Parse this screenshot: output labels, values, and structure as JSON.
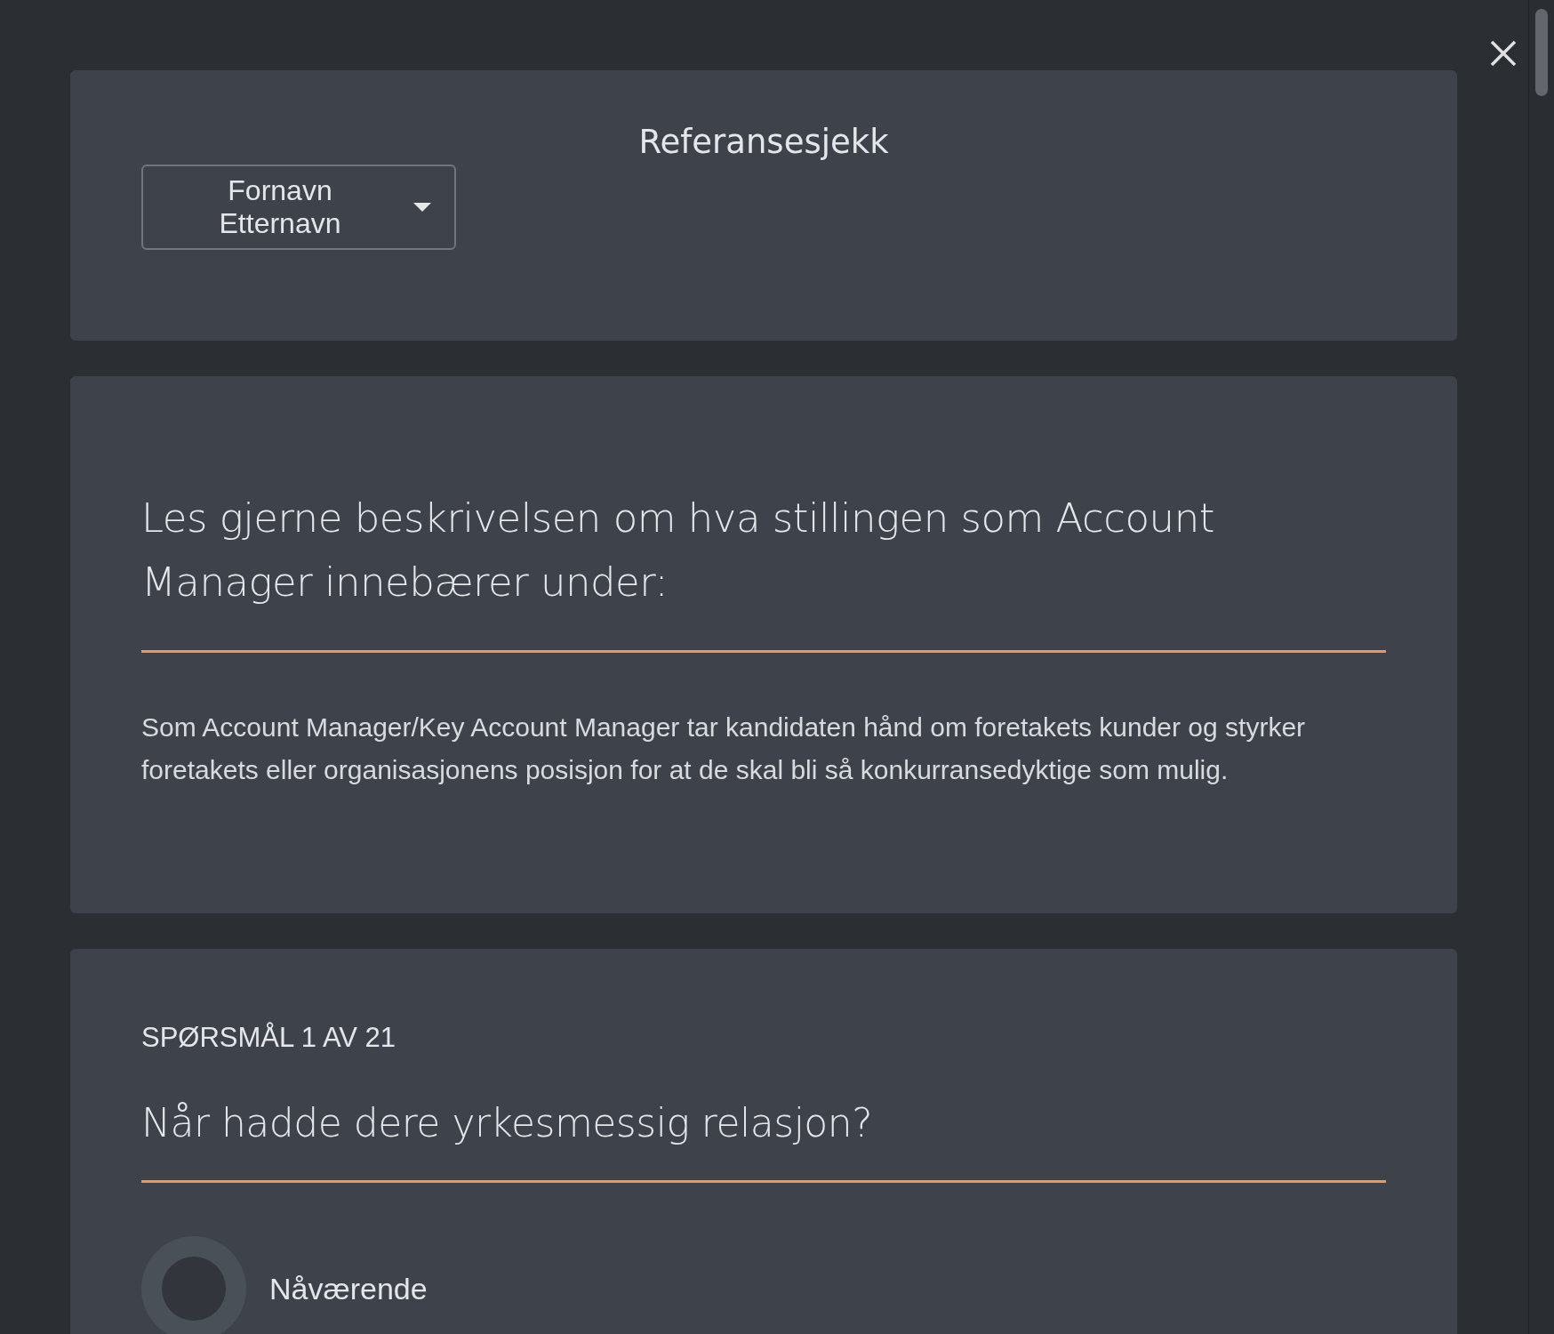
{
  "title": "Referansesjekk",
  "person_select": {
    "value": "Fornavn Etternavn"
  },
  "description_card": {
    "heading": "Les gjerne beskrivelsen om hva stillingen som Account Manager innebærer under:",
    "text": "Som Account Manager/Key Account Manager tar kandidaten hånd om foretakets kunder og styrker foretakets eller organisasjonens posisjon for at de skal bli så konkurransedyktige som mulig."
  },
  "question_card": {
    "counter": "SPØRSMÅL 1 AV 21",
    "question": "Når hadde dere yrkesmessig relasjon?",
    "options": [
      {
        "label": "Nåværende",
        "selected": false
      }
    ]
  }
}
